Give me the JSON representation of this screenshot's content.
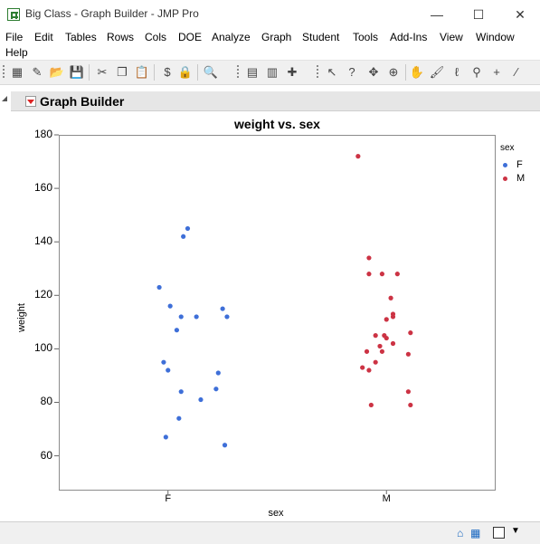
{
  "window": {
    "title": "Big Class - Graph Builder - JMP Pro",
    "minimize_label": "—",
    "maximize_label": "☐",
    "close_label": "✕"
  },
  "menu": {
    "items": [
      "File",
      "Edit",
      "Tables",
      "Rows",
      "Cols",
      "DOE",
      "Analyze",
      "Graph",
      "Student",
      "Tools",
      "Add-Ins",
      "View",
      "Window",
      "Help"
    ]
  },
  "toolbar": {
    "icons": [
      {
        "name": "new-data-table-icon",
        "glyph": "▦"
      },
      {
        "name": "new-script-icon",
        "glyph": "✎"
      },
      {
        "name": "open-icon",
        "glyph": "📂"
      },
      {
        "name": "save-icon",
        "glyph": "💾"
      },
      {
        "name": "cut-icon",
        "glyph": "✂"
      },
      {
        "name": "copy-icon",
        "glyph": "❐"
      },
      {
        "name": "paste-icon",
        "glyph": "📋"
      },
      {
        "name": "script-icon",
        "glyph": "$"
      },
      {
        "name": "lock-icon",
        "glyph": "🔒"
      },
      {
        "name": "search-icon",
        "glyph": "🔍"
      },
      {
        "name": "journal-icon",
        "glyph": "▤"
      },
      {
        "name": "layout-icon",
        "glyph": "▥"
      },
      {
        "name": "add-layout-icon",
        "glyph": "✚"
      },
      {
        "name": "arrow-tool-icon",
        "glyph": "↖"
      },
      {
        "name": "help-tool-icon",
        "glyph": "?"
      },
      {
        "name": "selection-tool-icon",
        "glyph": "✥"
      },
      {
        "name": "crosshair-tool-icon",
        "glyph": "⊕"
      },
      {
        "name": "grabber-tool-icon",
        "glyph": "✋"
      },
      {
        "name": "brush-tool-icon",
        "glyph": "🖌"
      },
      {
        "name": "lasso-tool-icon",
        "glyph": "ℓ"
      },
      {
        "name": "magnifier-tool-icon",
        "glyph": "⚲"
      },
      {
        "name": "crosshairs-icon",
        "glyph": "+"
      },
      {
        "name": "line-tool-icon",
        "glyph": "⁄"
      }
    ]
  },
  "outline": {
    "title": "Graph Builder"
  },
  "chart_data": {
    "type": "scatter",
    "title": "weight vs. sex",
    "xlabel": "sex",
    "ylabel": "weight",
    "categories": [
      "F",
      "M"
    ],
    "ylim": [
      47,
      180
    ],
    "yticks": [
      60,
      80,
      100,
      120,
      140,
      160,
      180
    ],
    "grid": false,
    "legend_title": "sex",
    "legend_position": "right",
    "series": [
      {
        "name": "F",
        "color": "#3e6fd8",
        "points": [
          {
            "x": "F",
            "jitter": 0.96,
            "y": 123
          },
          {
            "x": "F",
            "jitter": 0.98,
            "y": 95
          },
          {
            "x": "F",
            "jitter": 0.99,
            "y": 67
          },
          {
            "x": "F",
            "jitter": 1.0,
            "y": 92
          },
          {
            "x": "F",
            "jitter": 1.01,
            "y": 116
          },
          {
            "x": "F",
            "jitter": 1.04,
            "y": 107
          },
          {
            "x": "F",
            "jitter": 1.05,
            "y": 74
          },
          {
            "x": "F",
            "jitter": 1.06,
            "y": 112
          },
          {
            "x": "F",
            "jitter": 1.06,
            "y": 84
          },
          {
            "x": "F",
            "jitter": 1.07,
            "y": 142
          },
          {
            "x": "F",
            "jitter": 1.09,
            "y": 145
          },
          {
            "x": "F",
            "jitter": 1.13,
            "y": 112
          },
          {
            "x": "F",
            "jitter": 1.15,
            "y": 81
          },
          {
            "x": "F",
            "jitter": 1.22,
            "y": 85
          },
          {
            "x": "F",
            "jitter": 1.23,
            "y": 91
          },
          {
            "x": "F",
            "jitter": 1.25,
            "y": 115
          },
          {
            "x": "F",
            "jitter": 1.26,
            "y": 64
          },
          {
            "x": "F",
            "jitter": 1.27,
            "y": 112
          }
        ]
      },
      {
        "name": "M",
        "color": "#cc3344",
        "points": [
          {
            "x": "M",
            "jitter": 1.87,
            "y": 172
          },
          {
            "x": "M",
            "jitter": 1.89,
            "y": 93
          },
          {
            "x": "M",
            "jitter": 1.91,
            "y": 99
          },
          {
            "x": "M",
            "jitter": 1.92,
            "y": 128
          },
          {
            "x": "M",
            "jitter": 1.92,
            "y": 134
          },
          {
            "x": "M",
            "jitter": 1.93,
            "y": 79
          },
          {
            "x": "M",
            "jitter": 1.92,
            "y": 92
          },
          {
            "x": "M",
            "jitter": 1.95,
            "y": 105
          },
          {
            "x": "M",
            "jitter": 1.95,
            "y": 95
          },
          {
            "x": "M",
            "jitter": 1.97,
            "y": 101
          },
          {
            "x": "M",
            "jitter": 1.98,
            "y": 128
          },
          {
            "x": "M",
            "jitter": 1.98,
            "y": 99
          },
          {
            "x": "M",
            "jitter": 1.99,
            "y": 105
          },
          {
            "x": "M",
            "jitter": 2.0,
            "y": 104
          },
          {
            "x": "M",
            "jitter": 2.0,
            "y": 111
          },
          {
            "x": "M",
            "jitter": 2.02,
            "y": 119
          },
          {
            "x": "M",
            "jitter": 2.03,
            "y": 113
          },
          {
            "x": "M",
            "jitter": 2.03,
            "y": 112
          },
          {
            "x": "M",
            "jitter": 2.03,
            "y": 102
          },
          {
            "x": "M",
            "jitter": 2.05,
            "y": 128
          },
          {
            "x": "M",
            "jitter": 2.1,
            "y": 98
          },
          {
            "x": "M",
            "jitter": 2.1,
            "y": 84
          },
          {
            "x": "M",
            "jitter": 2.11,
            "y": 106
          },
          {
            "x": "M",
            "jitter": 2.11,
            "y": 79
          }
        ]
      }
    ]
  },
  "statusbar": {
    "home_icon": "home-icon",
    "window_list_icon": "window-list-icon"
  }
}
